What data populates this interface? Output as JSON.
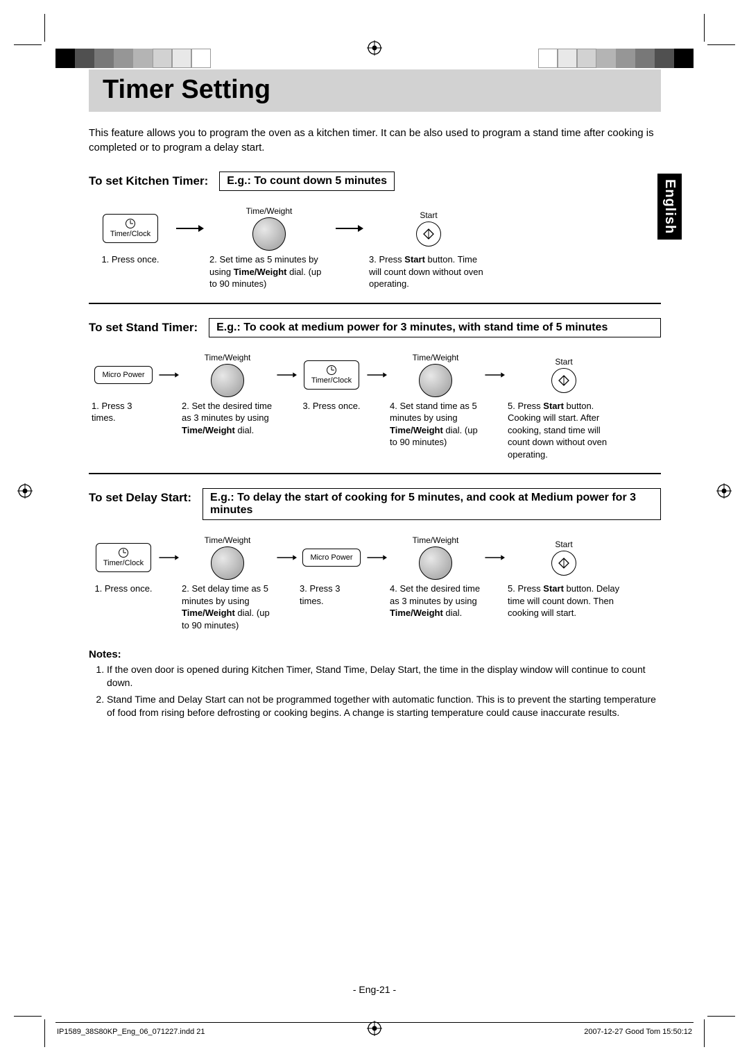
{
  "title": "Timer Setting",
  "intro": "This feature allows you to program the oven as a kitchen timer. It can be also used to program a stand time after cooking is completed or to program a delay start.",
  "lang_tab": "English",
  "buttons": {
    "timer_clock": "Timer/Clock",
    "micro_power": "Micro Power",
    "time_weight": "Time/Weight",
    "start": "Start"
  },
  "kitchen": {
    "label": "To set Kitchen Timer:",
    "eg": "E.g.: To count down 5 minutes",
    "steps": [
      {
        "text": "1. Press once."
      },
      {
        "text_html": "2. Set time as 5 minutes by using <b>Time/Weight</b> dial. (up to 90 minutes)"
      },
      {
        "text_html": "3. Press <b>Start</b> button. Time will count down without oven operating."
      }
    ]
  },
  "stand": {
    "label": "To set Stand Timer:",
    "eg": "E.g.: To cook at medium power for 3 minutes, with stand time of 5 minutes",
    "steps": [
      {
        "text": "1. Press 3 times."
      },
      {
        "text_html": "2. Set the desired time as 3 minutes by using <b>Time/Weight</b> dial."
      },
      {
        "text": "3. Press once."
      },
      {
        "text_html": "4. Set stand time as 5 minutes by using <b>Time/Weight</b> dial. (up to 90 minutes)"
      },
      {
        "text_html": "5. Press <b>Start</b> button. Cooking will start. After cooking, stand time will count down without oven operating."
      }
    ]
  },
  "delay": {
    "label": "To set Delay Start:",
    "eg": "E.g.: To delay the start of cooking for 5 minutes, and cook at Medium power for 3 minutes",
    "steps": [
      {
        "text": "1. Press once."
      },
      {
        "text_html": "2. Set delay time as 5 minutes by using <b>Time/Weight</b> dial. (up to 90 minutes)"
      },
      {
        "text": "3. Press 3 times."
      },
      {
        "text_html": "4. Set the desired time as 3 minutes by using <b>Time/Weight</b> dial."
      },
      {
        "text_html": "5. Press <b>Start</b> button. Delay time will count down. Then cooking will start."
      }
    ]
  },
  "notes": {
    "title": "Notes:",
    "items": [
      "If the oven door is opened during Kitchen Timer, Stand Time, Delay Start, the time in the display window will continue to count down.",
      "Stand Time and Delay Start can not be programmed together with automatic function. This is to prevent the starting temperature of food from rising before defrosting or cooking begins. A change is starting temperature could cause inaccurate results."
    ]
  },
  "page_num": "- Eng-21 -",
  "footer_left": "IP1589_38S80KP_Eng_06_071227.indd   21",
  "footer_right": "2007-12-27   Good Tom 15:50:12"
}
